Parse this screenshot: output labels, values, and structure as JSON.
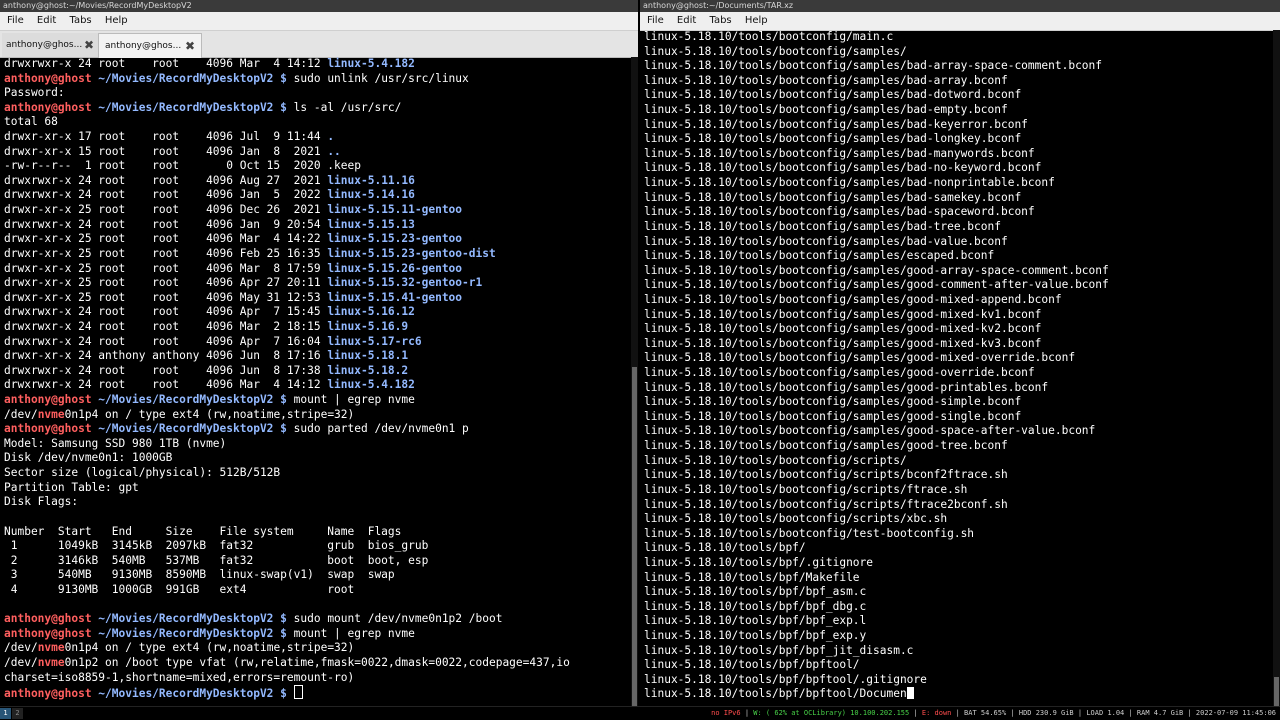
{
  "left_window": {
    "title": "anthony@ghost:~/Movies/RecordMyDesktopV2",
    "menu": [
      "File",
      "Edit",
      "Tabs",
      "Help"
    ],
    "tabs": [
      {
        "label": "anthony@ghos...",
        "active": false
      },
      {
        "label": "anthony@ghos...",
        "active": true
      }
    ],
    "lines": [
      [
        [
          "drwxrwxr-x 24 root    root    4096 Mar  4 14:12 ",
          ""
        ],
        [
          "linux-5.4.182",
          "blue"
        ]
      ],
      [
        [
          "anthony@ghost",
          "red"
        ],
        [
          " ~/Movies/RecordMyDesktopV2 $ ",
          "blue"
        ],
        [
          "sudo unlink /usr/src/linux",
          ""
        ]
      ],
      [
        [
          "Password:",
          ""
        ]
      ],
      [
        [
          "anthony@ghost",
          "red"
        ],
        [
          " ~/Movies/RecordMyDesktopV2 $ ",
          "blue"
        ],
        [
          "ls -al /usr/src/",
          ""
        ]
      ],
      [
        [
          "total 68",
          ""
        ]
      ],
      [
        [
          "drwxr-xr-x 17 root    root    4096 Jul  9 11:44 ",
          ""
        ],
        [
          ".",
          "blue"
        ]
      ],
      [
        [
          "drwxr-xr-x 15 root    root    4096 Jan  8  2021 ",
          ""
        ],
        [
          "..",
          "blue"
        ]
      ],
      [
        [
          "-rw-r--r--  1 root    root       0 Oct 15  2020 .keep",
          ""
        ]
      ],
      [
        [
          "drwxrwxr-x 24 root    root    4096 Aug 27  2021 ",
          ""
        ],
        [
          "linux-5.11.16",
          "blue"
        ]
      ],
      [
        [
          "drwxrwxr-x 24 root    root    4096 Jan  5  2022 ",
          ""
        ],
        [
          "linux-5.14.16",
          "blue"
        ]
      ],
      [
        [
          "drwxr-xr-x 25 root    root    4096 Dec 26  2021 ",
          ""
        ],
        [
          "linux-5.15.11-gentoo",
          "blue"
        ]
      ],
      [
        [
          "drwxrwxr-x 24 root    root    4096 Jan  9 20:54 ",
          ""
        ],
        [
          "linux-5.15.13",
          "blue"
        ]
      ],
      [
        [
          "drwxr-xr-x 25 root    root    4096 Mar  4 14:22 ",
          ""
        ],
        [
          "linux-5.15.23-gentoo",
          "blue"
        ]
      ],
      [
        [
          "drwxr-xr-x 25 root    root    4096 Feb 25 16:35 ",
          ""
        ],
        [
          "linux-5.15.23-gentoo-dist",
          "blue"
        ]
      ],
      [
        [
          "drwxr-xr-x 25 root    root    4096 Mar  8 17:59 ",
          ""
        ],
        [
          "linux-5.15.26-gentoo",
          "blue"
        ]
      ],
      [
        [
          "drwxr-xr-x 25 root    root    4096 Apr 27 20:11 ",
          ""
        ],
        [
          "linux-5.15.32-gentoo-r1",
          "blue"
        ]
      ],
      [
        [
          "drwxr-xr-x 25 root    root    4096 May 31 12:53 ",
          ""
        ],
        [
          "linux-5.15.41-gentoo",
          "blue"
        ]
      ],
      [
        [
          "drwxrwxr-x 24 root    root    4096 Apr  7 15:45 ",
          ""
        ],
        [
          "linux-5.16.12",
          "blue"
        ]
      ],
      [
        [
          "drwxrwxr-x 24 root    root    4096 Mar  2 18:15 ",
          ""
        ],
        [
          "linux-5.16.9",
          "blue"
        ]
      ],
      [
        [
          "drwxrwxr-x 24 root    root    4096 Apr  7 16:04 ",
          ""
        ],
        [
          "linux-5.17-rc6",
          "blue"
        ]
      ],
      [
        [
          "drwxr-xr-x 24 anthony anthony 4096 Jun  8 17:16 ",
          ""
        ],
        [
          "linux-5.18.1",
          "blue"
        ]
      ],
      [
        [
          "drwxrwxr-x 24 root    root    4096 Jun  8 17:38 ",
          ""
        ],
        [
          "linux-5.18.2",
          "blue"
        ]
      ],
      [
        [
          "drwxrwxr-x 24 root    root    4096 Mar  4 14:12 ",
          ""
        ],
        [
          "linux-5.4.182",
          "blue"
        ]
      ],
      [
        [
          "anthony@ghost",
          "red"
        ],
        [
          " ~/Movies/RecordMyDesktopV2 $ ",
          "blue"
        ],
        [
          "mount | egrep nvme",
          ""
        ]
      ],
      [
        [
          "/dev/",
          ""
        ],
        [
          "nvme",
          "red"
        ],
        [
          "0n1p4 on / type ext4 (rw,noatime,stripe=32)",
          ""
        ]
      ],
      [
        [
          "anthony@ghost",
          "red"
        ],
        [
          " ~/Movies/RecordMyDesktopV2 $ ",
          "blue"
        ],
        [
          "sudo parted /dev/nvme0n1 p",
          ""
        ]
      ],
      [
        [
          "Model: Samsung SSD 980 1TB (nvme)",
          ""
        ]
      ],
      [
        [
          "Disk /dev/nvme0n1: 1000GB",
          ""
        ]
      ],
      [
        [
          "Sector size (logical/physical): 512B/512B",
          ""
        ]
      ],
      [
        [
          "Partition Table: gpt",
          ""
        ]
      ],
      [
        [
          "Disk Flags:",
          ""
        ]
      ],
      [
        [
          "",
          ""
        ]
      ],
      [
        [
          "Number  Start   End     Size    File system     Name  Flags",
          ""
        ]
      ],
      [
        [
          " 1      1049kB  3145kB  2097kB  fat32           grub  bios_grub",
          ""
        ]
      ],
      [
        [
          " 2      3146kB  540MB   537MB   fat32           boot  boot, esp",
          ""
        ]
      ],
      [
        [
          " 3      540MB   9130MB  8590MB  linux-swap(v1)  swap  swap",
          ""
        ]
      ],
      [
        [
          " 4      9130MB  1000GB  991GB   ext4            root",
          ""
        ]
      ],
      [
        [
          "",
          ""
        ]
      ],
      [
        [
          "anthony@ghost",
          "red"
        ],
        [
          " ~/Movies/RecordMyDesktopV2 $ ",
          "blue"
        ],
        [
          "sudo mount /dev/nvme0n1p2 /boot",
          ""
        ]
      ],
      [
        [
          "anthony@ghost",
          "red"
        ],
        [
          " ~/Movies/RecordMyDesktopV2 $ ",
          "blue"
        ],
        [
          "mount | egrep nvme",
          ""
        ]
      ],
      [
        [
          "/dev/",
          ""
        ],
        [
          "nvme",
          "red"
        ],
        [
          "0n1p4 on / type ext4 (rw,noatime,stripe=32)",
          ""
        ]
      ],
      [
        [
          "/dev/",
          ""
        ],
        [
          "nvme",
          "red"
        ],
        [
          "0n1p2 on /boot type vfat (rw,relatime,fmask=0022,dmask=0022,codepage=437,io",
          ""
        ]
      ],
      [
        [
          "charset=iso8859-1,shortname=mixed,errors=remount-ro)",
          ""
        ]
      ],
      [
        [
          "anthony@ghost",
          "red"
        ],
        [
          " ~/Movies/RecordMyDesktopV2 $ ",
          "blue"
        ]
      ]
    ]
  },
  "right_window": {
    "title": "anthony@ghost:~/Documents/TAR.xz",
    "menu": [
      "File",
      "Edit",
      "Tabs",
      "Help"
    ],
    "lines": [
      "linux-5.18.10/tools/bootconfig/main.c",
      "linux-5.18.10/tools/bootconfig/samples/",
      "linux-5.18.10/tools/bootconfig/samples/bad-array-space-comment.bconf",
      "linux-5.18.10/tools/bootconfig/samples/bad-array.bconf",
      "linux-5.18.10/tools/bootconfig/samples/bad-dotword.bconf",
      "linux-5.18.10/tools/bootconfig/samples/bad-empty.bconf",
      "linux-5.18.10/tools/bootconfig/samples/bad-keyerror.bconf",
      "linux-5.18.10/tools/bootconfig/samples/bad-longkey.bconf",
      "linux-5.18.10/tools/bootconfig/samples/bad-manywords.bconf",
      "linux-5.18.10/tools/bootconfig/samples/bad-no-keyword.bconf",
      "linux-5.18.10/tools/bootconfig/samples/bad-nonprintable.bconf",
      "linux-5.18.10/tools/bootconfig/samples/bad-samekey.bconf",
      "linux-5.18.10/tools/bootconfig/samples/bad-spaceword.bconf",
      "linux-5.18.10/tools/bootconfig/samples/bad-tree.bconf",
      "linux-5.18.10/tools/bootconfig/samples/bad-value.bconf",
      "linux-5.18.10/tools/bootconfig/samples/escaped.bconf",
      "linux-5.18.10/tools/bootconfig/samples/good-array-space-comment.bconf",
      "linux-5.18.10/tools/bootconfig/samples/good-comment-after-value.bconf",
      "linux-5.18.10/tools/bootconfig/samples/good-mixed-append.bconf",
      "linux-5.18.10/tools/bootconfig/samples/good-mixed-kv1.bconf",
      "linux-5.18.10/tools/bootconfig/samples/good-mixed-kv2.bconf",
      "linux-5.18.10/tools/bootconfig/samples/good-mixed-kv3.bconf",
      "linux-5.18.10/tools/bootconfig/samples/good-mixed-override.bconf",
      "linux-5.18.10/tools/bootconfig/samples/good-override.bconf",
      "linux-5.18.10/tools/bootconfig/samples/good-printables.bconf",
      "linux-5.18.10/tools/bootconfig/samples/good-simple.bconf",
      "linux-5.18.10/tools/bootconfig/samples/good-single.bconf",
      "linux-5.18.10/tools/bootconfig/samples/good-space-after-value.bconf",
      "linux-5.18.10/tools/bootconfig/samples/good-tree.bconf",
      "linux-5.18.10/tools/bootconfig/scripts/",
      "linux-5.18.10/tools/bootconfig/scripts/bconf2ftrace.sh",
      "linux-5.18.10/tools/bootconfig/scripts/ftrace.sh",
      "linux-5.18.10/tools/bootconfig/scripts/ftrace2bconf.sh",
      "linux-5.18.10/tools/bootconfig/scripts/xbc.sh",
      "linux-5.18.10/tools/bootconfig/test-bootconfig.sh",
      "linux-5.18.10/tools/bpf/",
      "linux-5.18.10/tools/bpf/.gitignore",
      "linux-5.18.10/tools/bpf/Makefile",
      "linux-5.18.10/tools/bpf/bpf_asm.c",
      "linux-5.18.10/tools/bpf/bpf_dbg.c",
      "linux-5.18.10/tools/bpf/bpf_exp.l",
      "linux-5.18.10/tools/bpf/bpf_exp.y",
      "linux-5.18.10/tools/bpf/bpf_jit_disasm.c",
      "linux-5.18.10/tools/bpf/bpftool/",
      "linux-5.18.10/tools/bpf/bpftool/.gitignore",
      "linux-5.18.10/tools/bpf/bpftool/Documen"
    ]
  },
  "statusbar": {
    "workspaces": [
      "1",
      "2"
    ],
    "items": [
      {
        "text": "no IPv6",
        "color": "red"
      },
      {
        "text": "W: ( 62% at OCLibrary) 10.100.202.155",
        "color": "green"
      },
      {
        "text": "E: down",
        "color": "red"
      },
      {
        "text": "BAT 54.65%",
        "color": "dim"
      },
      {
        "text": "HDD 230.9 GiB",
        "color": "dim"
      },
      {
        "text": "LOAD 1.04",
        "color": "dim"
      },
      {
        "text": "RAM 4.7 GiB",
        "color": "dim"
      },
      {
        "text": "2022-07-09 11:45:06",
        "color": "dim"
      }
    ]
  }
}
